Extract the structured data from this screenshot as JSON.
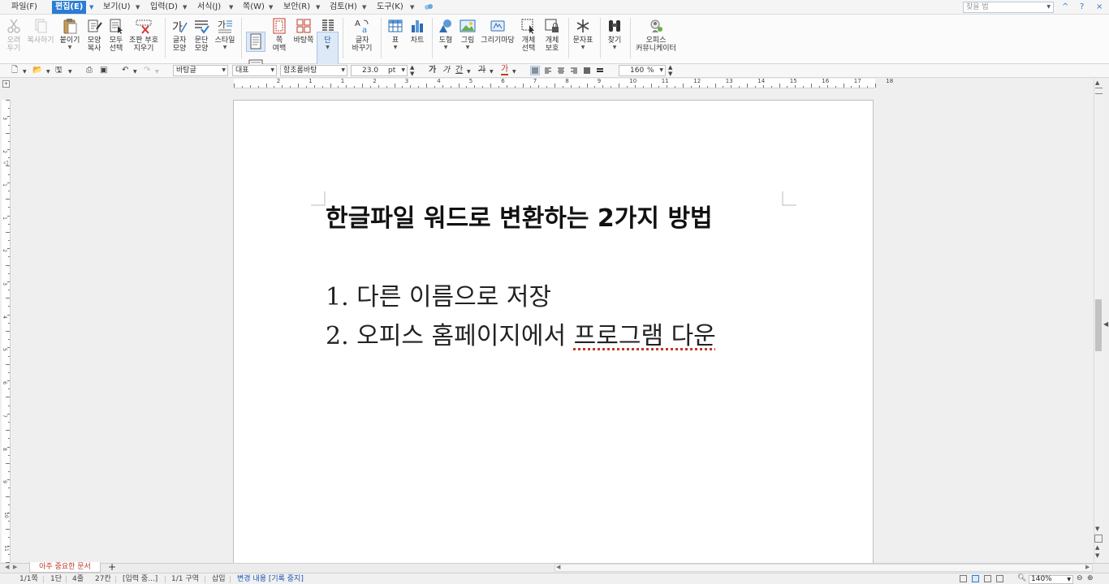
{
  "menu": {
    "items": [
      {
        "label": "파일(F)"
      },
      {
        "label": "편집(E)"
      },
      {
        "label": "보기(U)"
      },
      {
        "label": "입력(D)"
      },
      {
        "label": "서식(J)"
      },
      {
        "label": "쪽(W)"
      },
      {
        "label": "보안(R)"
      },
      {
        "label": "검토(H)"
      },
      {
        "label": "도구(K)"
      }
    ],
    "active_index": 1,
    "search_placeholder": "찾을 법",
    "window_buttons": [
      "^",
      "?",
      "×"
    ]
  },
  "ribbon": {
    "buttons": [
      {
        "label": "오려\n두기",
        "disabled": true
      },
      {
        "label": "복사하기",
        "disabled": true
      },
      {
        "label": "붙이기"
      },
      {
        "label": "모양\n복사"
      },
      {
        "label": "모두\n선택"
      },
      {
        "label": "조판 부호\n지우기"
      },
      {
        "label": "글자\n모양"
      },
      {
        "label": "문단\n모양"
      },
      {
        "label": "스타일"
      },
      {
        "label": "쪽\n여백"
      },
      {
        "label": "바탕쪽"
      },
      {
        "label": "단"
      },
      {
        "label": "글자\n바꾸기"
      },
      {
        "label": "표"
      },
      {
        "label": "차트"
      },
      {
        "label": "도형"
      },
      {
        "label": "그림"
      },
      {
        "label": "그리기마당"
      },
      {
        "label": "개체\n선택"
      },
      {
        "label": "개체\n보호"
      },
      {
        "label": "문자표"
      },
      {
        "label": "찾기"
      },
      {
        "label": "오피스\n커뮤니케이터"
      }
    ]
  },
  "format_bar": {
    "style": "바탕글",
    "lang": "대표",
    "font": "함초롬바탕",
    "size": "23.0",
    "size_unit": "pt",
    "zoom": "160",
    "zoom_unit": "%",
    "char_buttons": [
      "가",
      "가",
      "간",
      "가",
      "가"
    ]
  },
  "ruler": {
    "h_ticks": [
      "2",
      "1",
      "1",
      "2",
      "3",
      "4",
      "5",
      "6",
      "7",
      "8",
      "9",
      "10",
      "11",
      "12",
      "13",
      "14",
      "15",
      "16",
      "17",
      "18"
    ],
    "v_ticks": [
      "3",
      "2",
      "1",
      "1",
      "2",
      "3",
      "4",
      "5",
      "6",
      "7",
      "8",
      "9",
      "10",
      "11"
    ]
  },
  "document": {
    "title": "한글파일 워드로 변환하는 2가지 방법",
    "lines": [
      {
        "text": "1. 다른 이름으로 저장"
      },
      {
        "text_main": "2. 오피스 홈페이지에서 ",
        "text_spell": "프로그램 다운"
      }
    ]
  },
  "tabs": {
    "doc_tab": "아주 중요한 문서",
    "add_label": "+"
  },
  "status": {
    "page": "1/1쪽",
    "column": "1단",
    "line": "4줄",
    "col": "27칸",
    "mode": "[입력 중...]",
    "section": "1/1 구역",
    "insert": "삽입",
    "track": "변경 내용 [기록 중지]",
    "zoom": "140%"
  },
  "colors": {
    "accent": "#2b7cd3",
    "status_link": "#1a56b8",
    "tab_text": "#c0392b"
  }
}
